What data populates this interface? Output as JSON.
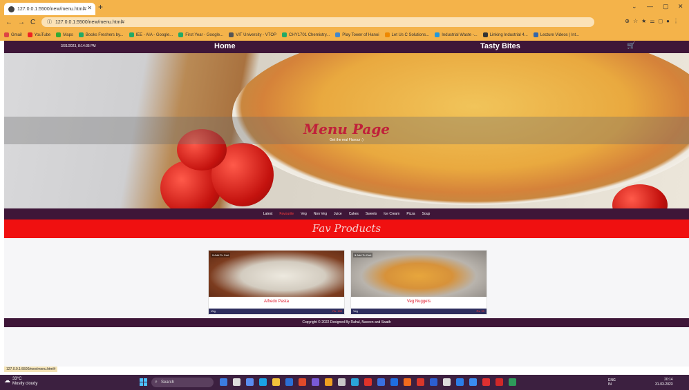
{
  "browser": {
    "tab_title": "127.0.0.1:5500/new/menu.html#",
    "new_tab": "+",
    "window_controls": [
      "⌄",
      "—",
      "▢",
      "✕"
    ],
    "url": "127.0.0.1:5500/new/menu.html#",
    "bookmarks": [
      "Gmail",
      "YouTube",
      "Maps",
      "Books Freshers by...",
      "IEE - AIA - Google...",
      "First Year - Google...",
      "VIT University - VTOP",
      "CHY1701 Chemistry...",
      "Play Tower of Hanoi",
      "Let Us C Solutions...",
      "Industrial Waste -...",
      "Linking Industrial 4...",
      "Lecture Videos | Int..."
    ]
  },
  "header": {
    "datetime": "3/31/2023, 8:14:35 PM",
    "home": "Home",
    "brand": "Tasty Bites",
    "cart_icon": "cart-icon"
  },
  "hero": {
    "title": "Menu Page",
    "subtitle": "Get the real Flavour :)"
  },
  "categories": [
    "Latest",
    "Favourite",
    "Veg",
    "Non Veg",
    "Juice",
    "Cakes",
    "Sweets",
    "Ice Cream",
    "Pizza",
    "Soup"
  ],
  "active_category": "Favourite",
  "favourites_title": "Fav Products",
  "products": [
    {
      "wish": "♥ Add To Cart",
      "name": "Alfredo Pasta",
      "type": "Veg",
      "price": "Rs. 150"
    },
    {
      "wish": "♥ Add To Cart",
      "name": "Veg Nuggets",
      "type": "Veg",
      "price": "Rs. 99"
    }
  ],
  "footer": "Copyright © 2022 Designed By Rahul, Naveen and Swath",
  "status_url": "127.0.0.1:5500/new/menu.html#",
  "taskbar": {
    "temp": "33°C",
    "weather": "Mostly cloudy",
    "search": "Search",
    "lang": "ENG",
    "region": "IN",
    "time": "20:14",
    "date": "31-03-2023"
  },
  "colors": {
    "nav_bg": "#3e1638",
    "fav_band": "#f01010",
    "accent_text": "#e0192d",
    "browser_frame": "#f4b34a"
  }
}
